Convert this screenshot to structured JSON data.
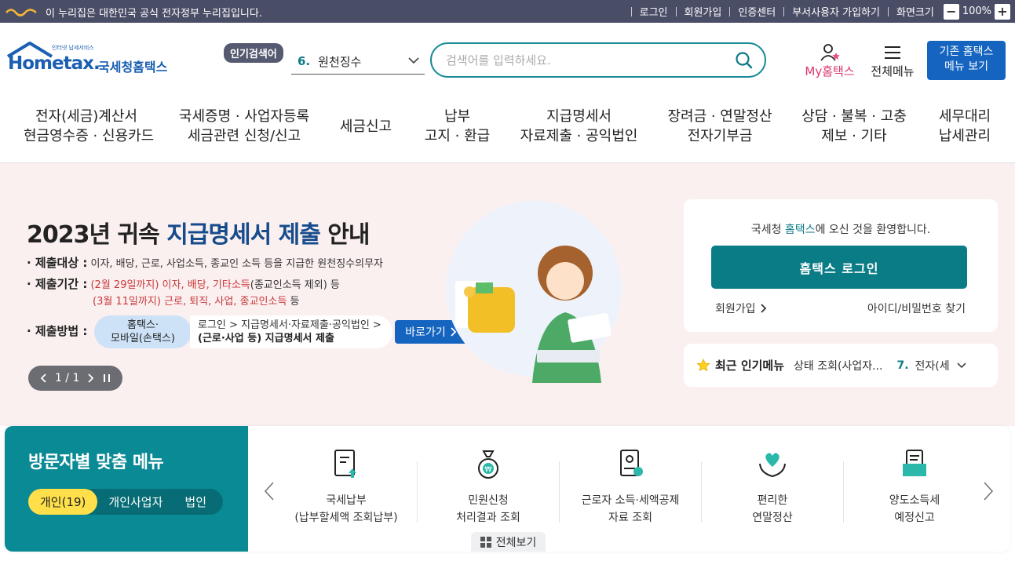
{
  "topbar": {
    "notice": "이 누리집은 대한민국 공식 전자정부 누리집입니다.",
    "links": [
      "로그인",
      "회원가입",
      "인증센터",
      "부서사용자 가입하기",
      "화면크기"
    ],
    "zoom": "100%"
  },
  "header": {
    "logo_small": "인터넷 납세서비스",
    "logo_main": "Hometax.",
    "logo_kr": "국세청홈택스",
    "popular_label": "인기검색어",
    "popular_num": "6.",
    "popular_term": "원천징수",
    "search_placeholder": "검색어를 입력하세요.",
    "my_label": "My홈택스",
    "all_menu_label": "전체메뉴",
    "old_btn_line1": "기존 홈택스",
    "old_btn_line2": "메뉴 보기"
  },
  "gnb": [
    {
      "l1": "전자(세금)계산서",
      "l2": "현금영수증 · 신용카드"
    },
    {
      "l1": "국세증명 · 사업자등록",
      "l2": "세금관련 신청/신고"
    },
    {
      "l1": "세금신고",
      "l2": ""
    },
    {
      "l1": "납부",
      "l2": "고지 · 환급"
    },
    {
      "l1": "지급명세서",
      "l2": "자료제출 · 공익법인"
    },
    {
      "l1": "장려금 · 연말정산",
      "l2": "전자기부금"
    },
    {
      "l1": "상담 · 불복 · 고충",
      "l2": "제보 · 기타"
    },
    {
      "l1": "세무대리",
      "l2": "납세관리"
    }
  ],
  "hero": {
    "title_a": "2023년 귀속 ",
    "title_b": "지급명세서 제출",
    "title_c": " 안내",
    "target_label": "· 제출대상 :",
    "target_text": "이자, 배당, 근로, 사업소득, 종교인 소득 등을 지급한 원천징수의무자",
    "period_label": "· 제출기간 :",
    "period1_red": "(2월 29일까지) 이자, 배당, 기타소득",
    "period1_rest": "(종교인소득 제외) 등",
    "period2_red": "(3월 11일까지) 근로, 퇴직, 사업, 종교인소득",
    "period2_rest": " 등",
    "method_label": "· 제출방법 :",
    "method_pill1": "홈택스·",
    "method_pill2": "모바일(손택스)",
    "method_path1": "로그인 > 지급명세서·자료제출·공익법인 >",
    "method_path2": "(근로·사업 등) 지급명세서 제출",
    "go_btn": "바로가기",
    "pager": "1 / 1"
  },
  "login": {
    "welcome_a": "국세청 ",
    "welcome_b": "홈택스",
    "welcome_c": "에 오신 것을 환영합니다.",
    "login_btn": "홈택스 로그인",
    "join": "회원가입",
    "find": "아이디/비밀번호 찾기"
  },
  "recent": {
    "title": "최근 인기메뉴",
    "item1": "상태 조회(사업자...",
    "num2": "7.",
    "item2": "전자(세"
  },
  "visitor": {
    "title": "방문자별 맞춤 메뉴",
    "tabs": [
      "개인(19)",
      "개인사업자",
      "법인"
    ],
    "items": [
      {
        "l1": "국세납부",
        "l2": "(납부할세액 조회납부)"
      },
      {
        "l1": "민원신청",
        "l2": "처리결과 조회"
      },
      {
        "l1": "근로자 소득·세액공제",
        "l2": "자료 조회"
      },
      {
        "l1": "편리한",
        "l2": "연말정산"
      },
      {
        "l1": "양도소득세",
        "l2": "예정신고"
      }
    ],
    "all_view": "전체보기"
  },
  "colors": {
    "teal": "#0a8a94",
    "blue": "#1564c0",
    "navy_bar": "#4a4d66",
    "hero_bg": "#fbf0f0",
    "accent_red": "#c9383a"
  }
}
